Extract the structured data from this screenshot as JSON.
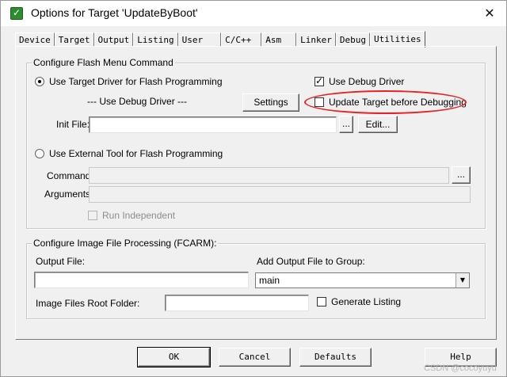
{
  "window": {
    "title": "Options for Target 'UpdateByBoot'",
    "close_glyph": "✕"
  },
  "tabs": [
    "Device",
    "Target",
    "Output",
    "Listing",
    "User",
    "C/C++",
    "Asm",
    "Linker",
    "Debug",
    "Utilities"
  ],
  "active_tab": "Utilities",
  "flash_group": {
    "title": "Configure Flash Menu Command",
    "use_target_driver": {
      "label": "Use Target Driver for Flash Programming",
      "checked": true
    },
    "use_debug_driver": {
      "label": "Use Debug Driver",
      "checked": true
    },
    "driver_display": "--- Use Debug Driver ---",
    "settings_button": "Settings",
    "update_target": {
      "label": "Update Target before Debugging",
      "checked": false
    },
    "init_file_label": "Init File:",
    "init_file_value": "",
    "browse_button": "...",
    "edit_button": "Edit...",
    "use_external_tool": {
      "label": "Use External Tool for Flash Programming",
      "checked": false
    },
    "command_label": "Command:",
    "command_value": "",
    "command_browse": "...",
    "arguments_label": "Arguments:",
    "arguments_value": "",
    "run_independent": {
      "label": "Run Independent",
      "checked": false
    }
  },
  "image_group": {
    "title": "Configure Image File Processing (FCARM):",
    "output_file_label": "Output File:",
    "output_file_value": "",
    "add_output_label": "Add Output File  to Group:",
    "group_value": "main",
    "root_folder_label": "Image Files Root Folder:",
    "root_folder_value": "",
    "generate_listing": {
      "label": "Generate Listing",
      "checked": false
    }
  },
  "footer": {
    "ok": "OK",
    "cancel": "Cancel",
    "defaults": "Defaults",
    "help": "Help"
  },
  "annotation": {
    "color": "#e62222"
  },
  "watermark": "CSDN @cocoyuyu"
}
